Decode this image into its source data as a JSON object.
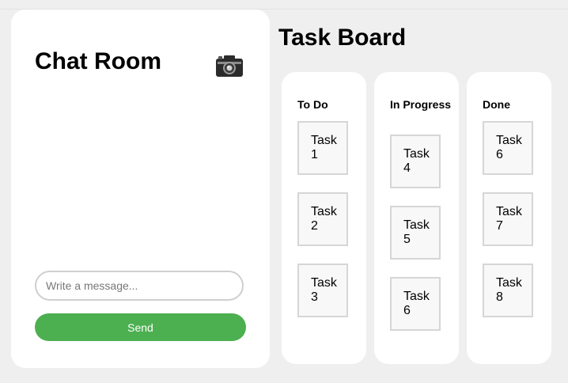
{
  "chat": {
    "title": "Chat Room",
    "camera_icon": "camera-icon",
    "input_placeholder": "Write a message...",
    "send_label": "Send"
  },
  "board": {
    "title": "Task Board",
    "columns": [
      {
        "title": "To Do",
        "tasks": [
          "Task 1",
          "Task 2",
          "Task 3"
        ]
      },
      {
        "title": "In Progress",
        "tasks": [
          "Task 4",
          "Task 5",
          "Task 6"
        ]
      },
      {
        "title": "Done",
        "tasks": [
          "Task 6",
          "Task 7",
          "Task 8"
        ]
      }
    ]
  },
  "colors": {
    "background": "#efefef",
    "panel": "#ffffff",
    "send_button": "#4caf50",
    "task_border": "#d6d6d6",
    "task_fill": "#f8f8f8"
  }
}
